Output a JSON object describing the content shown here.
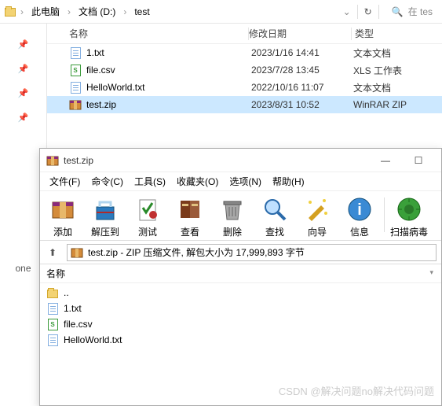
{
  "breadcrumb": {
    "segments": [
      "此电脑",
      "文档 (D:)",
      "test"
    ],
    "search_placeholder": "在 tes"
  },
  "explorer": {
    "cols": {
      "name": "名称",
      "date": "修改日期",
      "type": "类型"
    },
    "rows": [
      {
        "icon": "txt",
        "name": "1.txt",
        "date": "2023/1/16 14:41",
        "type": "文本文档",
        "selected": false
      },
      {
        "icon": "csv",
        "name": "file.csv",
        "date": "2023/7/28 13:45",
        "type": "XLS 工作表",
        "selected": false
      },
      {
        "icon": "txt",
        "name": "HelloWorld.txt",
        "date": "2022/10/16 11:07",
        "type": "文本文档",
        "selected": false
      },
      {
        "icon": "zip",
        "name": "test.zip",
        "date": "2023/8/31 10:52",
        "type": "WinRAR ZIP",
        "selected": true
      }
    ]
  },
  "sidebar_label": "one",
  "winrar": {
    "title": "test.zip",
    "menu": [
      "文件(F)",
      "命令(C)",
      "工具(S)",
      "收藏夹(O)",
      "选项(N)",
      "帮助(H)"
    ],
    "tools": [
      {
        "key": "add",
        "label": "添加"
      },
      {
        "key": "extract",
        "label": "解压到"
      },
      {
        "key": "test",
        "label": "测试"
      },
      {
        "key": "view",
        "label": "查看"
      },
      {
        "key": "delete",
        "label": "删除"
      },
      {
        "key": "find",
        "label": "查找"
      },
      {
        "key": "wizard",
        "label": "向导"
      },
      {
        "key": "info",
        "label": "信息"
      },
      {
        "key": "scan",
        "label": "扫描病毒"
      }
    ],
    "pathinfo": "test.zip - ZIP 压缩文件, 解包大小为 17,999,893 字节",
    "list_header": "名称",
    "entries": [
      {
        "icon": "up",
        "name": ".."
      },
      {
        "icon": "txt",
        "name": "1.txt"
      },
      {
        "icon": "csv",
        "name": "file.csv"
      },
      {
        "icon": "txt",
        "name": "HelloWorld.txt"
      }
    ]
  },
  "watermark": "CSDN @解决问题no解决代码问题"
}
